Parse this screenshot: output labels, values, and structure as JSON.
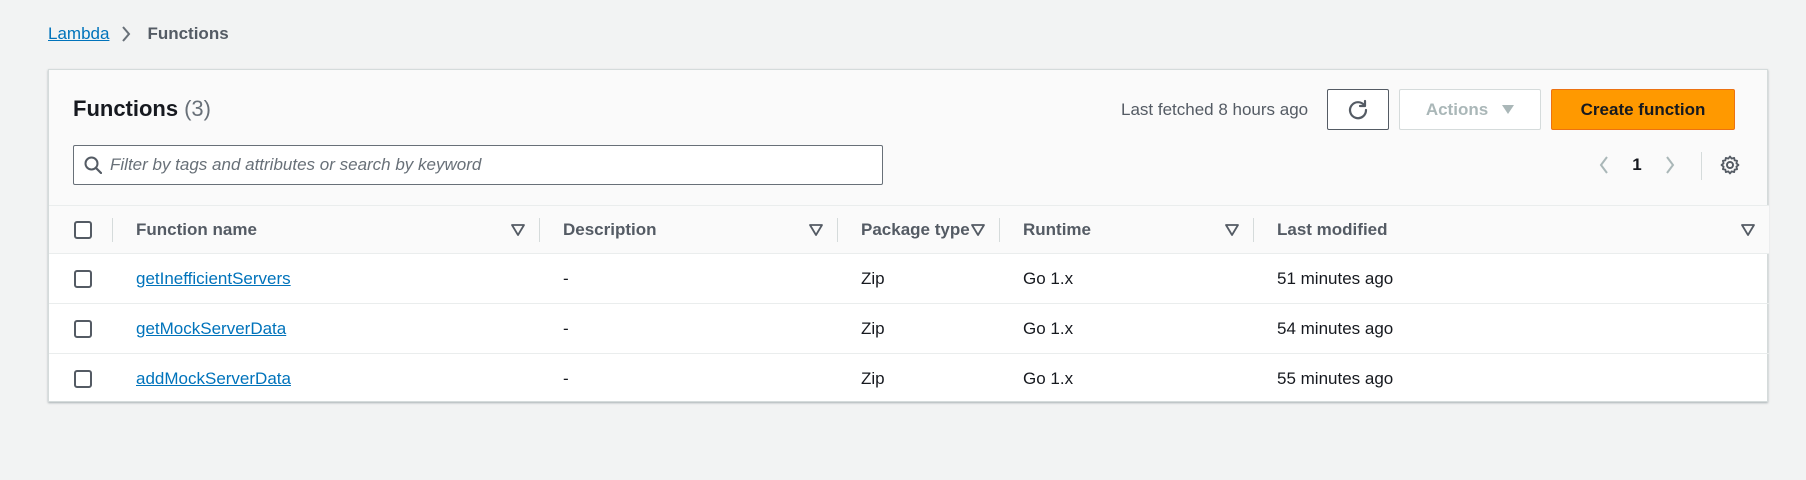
{
  "breadcrumb": {
    "items": [
      "Lambda",
      "Functions"
    ]
  },
  "header": {
    "title": "Functions",
    "count": "(3)",
    "last_fetched": "Last fetched 8 hours ago",
    "actions_label": "Actions",
    "create_label": "Create function"
  },
  "search": {
    "placeholder": "Filter by tags and attributes or search by keyword",
    "value": ""
  },
  "pagination": {
    "current_page": "1"
  },
  "table": {
    "columns": [
      "Function name",
      "Description",
      "Package type",
      "Runtime",
      "Last modified"
    ],
    "rows": [
      {
        "name": "getInefficientServers",
        "description": "-",
        "package_type": "Zip",
        "runtime": "Go 1.x",
        "last_modified": "51 minutes ago"
      },
      {
        "name": "getMockServerData",
        "description": "-",
        "package_type": "Zip",
        "runtime": "Go 1.x",
        "last_modified": "54 minutes ago"
      },
      {
        "name": "addMockServerData",
        "description": "-",
        "package_type": "Zip",
        "runtime": "Go 1.x",
        "last_modified": "55 minutes ago"
      }
    ]
  },
  "colors": {
    "accent_orange": "#ff9900",
    "link_blue": "#0073bb",
    "page_bg": "#f2f3f3"
  },
  "icons": {
    "breadcrumb_separator": "chevron-right-icon",
    "refresh": "refresh-icon",
    "actions_caret": "caret-down-icon",
    "search": "search-icon",
    "prev_page": "chevron-left-icon",
    "next_page": "chevron-right-icon",
    "settings": "gear-icon",
    "column_sort": "sort-caret-icon"
  }
}
